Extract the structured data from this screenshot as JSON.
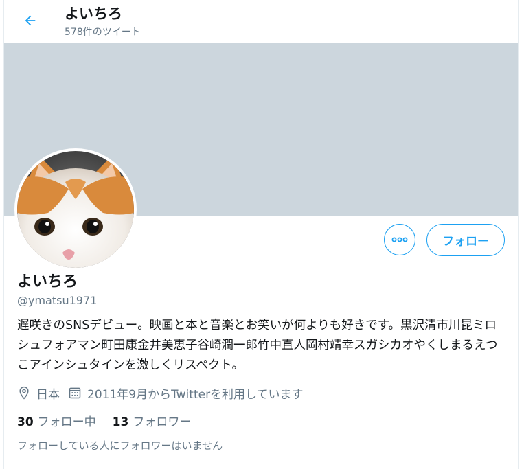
{
  "header": {
    "name": "よいちろ",
    "tweet_count": "578件のツイート"
  },
  "profile": {
    "display_name": "よいちろ",
    "handle": "@ymatsu1971",
    "bio": "遅咲きのSNSデビュー。映画と本と音楽とお笑いが何よりも好きです。黒沢清市川昆ミロシュフォアマン町田康金井美恵子谷崎潤一郎竹中直人岡村靖幸スガシカオやくしまるえつこアインシュタインを激しくリスペクト。",
    "location": "日本",
    "joined": "2011年9月からTwitterを利用しています",
    "following_count": "30",
    "following_label": "フォロー中",
    "followers_count": "13",
    "followers_label": "フォロワー",
    "mutual_note": "フォローしている人にフォロワーはいません"
  },
  "actions": {
    "follow_label": "フォロー",
    "more_icon": "more-icon"
  },
  "colors": {
    "accent": "#1da1f2",
    "banner": "#ccd6dd",
    "muted_text": "#657786",
    "text": "#14171a"
  },
  "icons": {
    "back": "back-arrow-icon",
    "location": "location-pin-icon",
    "calendar": "calendar-icon"
  }
}
